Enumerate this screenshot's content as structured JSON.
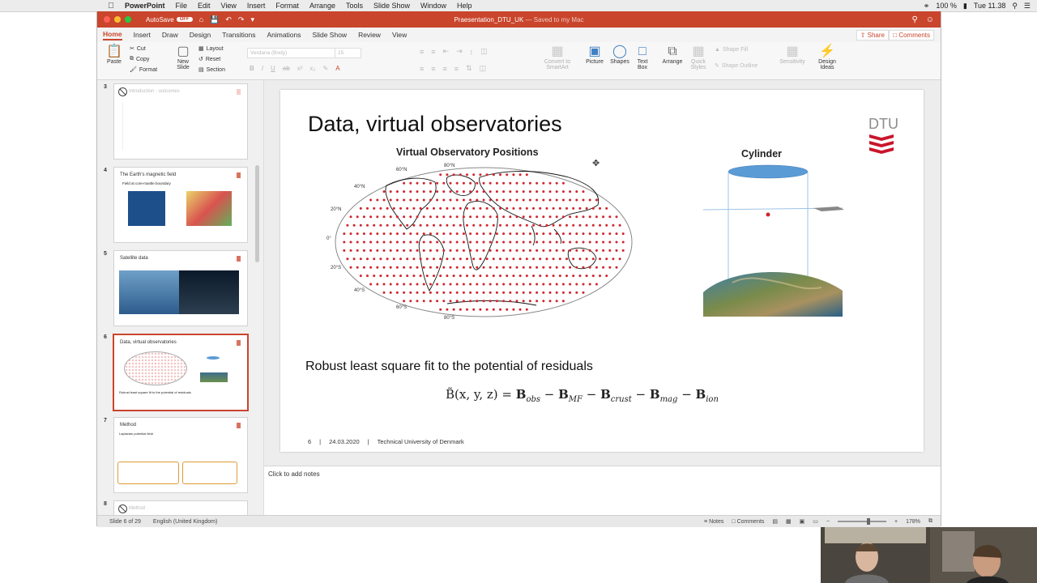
{
  "menubar": {
    "app": "PowerPoint",
    "items": [
      "File",
      "Edit",
      "View",
      "Insert",
      "Format",
      "Arrange",
      "Tools",
      "Slide Show",
      "Window",
      "Help"
    ],
    "battery": "100 %",
    "clock": "Tue 11.38"
  },
  "titlebar": {
    "autosave": "AutoSave",
    "autosave_state": "OFF",
    "doc_name": "Praesentation_DTU_UK",
    "doc_status": "— Saved to my Mac",
    "accent": "#c9452c"
  },
  "ribbon_tabs": {
    "tabs": [
      "Home",
      "Insert",
      "Draw",
      "Design",
      "Transitions",
      "Animations",
      "Slide Show",
      "Review",
      "View"
    ],
    "active": "Home",
    "share": "Share",
    "comments": "Comments"
  },
  "ribbon": {
    "paste": "Paste",
    "cut": "Cut",
    "copy": "Copy",
    "format": "Format",
    "new_slide": "New Slide",
    "layout": "Layout",
    "reset": "Reset",
    "section": "Section",
    "font": "Verdana (Body)",
    "size": "15",
    "convert": "Convert to SmartArt",
    "picture": "Picture",
    "shapes": "Shapes",
    "textbox": "Text Box",
    "arrange": "Arrange",
    "quick_styles": "Quick Styles",
    "shape_fill": "Shape Fill",
    "shape_outline": "Shape Outline",
    "sensitivity": "Sensitivity",
    "design_ideas": "Design Ideas"
  },
  "thumbnails": [
    {
      "num": "3",
      "title": "Introduction - outcomes",
      "hidden": true
    },
    {
      "num": "4",
      "title": "The Earth's magnetic field",
      "sub": "Field at core-mantle boundary"
    },
    {
      "num": "5",
      "title": "Satellite data"
    },
    {
      "num": "6",
      "title": "Data, virtual observatories",
      "sub": "Robust least square fit to the potential of residuals",
      "selected": true
    },
    {
      "num": "7",
      "title": "Method",
      "sub": "Laplacian potential field"
    },
    {
      "num": "8",
      "title": "Method",
      "hidden": true
    }
  ],
  "slide": {
    "title": "Data, virtual observatories",
    "logo": "DTU",
    "map_title": "Virtual Observatory Positions",
    "lat_labels": [
      "80°N",
      "60°N",
      "40°N",
      "20°N",
      "0°",
      "20°S",
      "40°S",
      "60°S",
      "80°S"
    ],
    "cylinder_title": "Cylinder",
    "robust": "Robust least square fit to the potential of residuals",
    "equation": {
      "lhs": "B̃(x, y, z) = ",
      "terms": [
        {
          "sym": "B",
          "sub": "obs",
          "op": ""
        },
        {
          "sym": "B",
          "sub": "MF",
          "op": " − "
        },
        {
          "sym": "B",
          "sub": "crust",
          "op": " − "
        },
        {
          "sym": "B",
          "sub": "mag",
          "op": " − "
        },
        {
          "sym": "B",
          "sub": "ion",
          "op": " − "
        }
      ]
    },
    "footer": {
      "num": "6",
      "sep": "|",
      "date": "24.03.2020",
      "org": "Technical University of Denmark"
    }
  },
  "notes": {
    "placeholder": "Click to add notes"
  },
  "status": {
    "slide_of": "Slide 6 of 29",
    "lang": "English (United Kingdom)",
    "notes": "Notes",
    "comments": "Comments",
    "zoom": "178%"
  }
}
